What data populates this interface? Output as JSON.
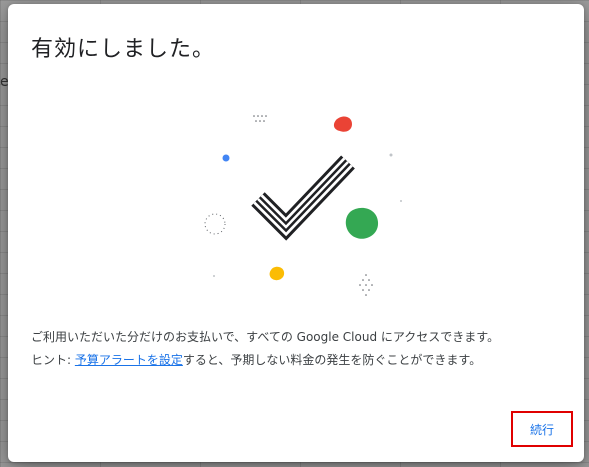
{
  "dialog": {
    "title": "有効にしました。",
    "message": "ご利用いただいた分だけのお支払いで、すべての Google Cloud にアクセスできます。",
    "hint_prefix": "ヒント: ",
    "hint_link": "予算アラートを設定",
    "hint_suffix": "すると、予期しない料金の発生を防ぐことができます。",
    "continue_label": "続行"
  },
  "colors": {
    "red_dot": "#ea4335",
    "blue_dot": "#4285f4",
    "green_dot": "#34a853",
    "yellow_dot": "#fbbc04",
    "link": "#1a73e8",
    "highlight_border": "#e00000"
  },
  "illustration": {
    "icon": "checkmark-icon"
  }
}
